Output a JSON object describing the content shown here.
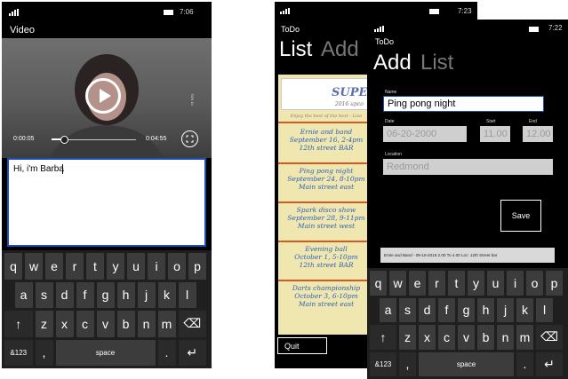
{
  "phone1": {
    "status_time": "7:06",
    "title": "Video",
    "elapsed": "0:00:05",
    "duration": "0:04:55",
    "text_value": "Hi, i'm Barba",
    "side_text": "TDN 10",
    "keyboard": {
      "row1": [
        "q",
        "w",
        "e",
        "r",
        "t",
        "y",
        "u",
        "i",
        "o",
        "p"
      ],
      "row2": [
        "a",
        "s",
        "d",
        "f",
        "g",
        "h",
        "j",
        "k",
        "l"
      ],
      "row3": [
        "z",
        "x",
        "c",
        "v",
        "b",
        "n",
        "m"
      ],
      "shift": "↑",
      "backspace": "⌫",
      "numbers": "&123",
      "comma": ",",
      "space": "space",
      "period": ".",
      "enter": "↵"
    }
  },
  "phone2": {
    "status_time": "7:23",
    "app_title": "ToDo",
    "pivot_active": "List",
    "pivot_inactive": "Add",
    "flyer_header": "SUPER",
    "flyer_sub": "2016 upco",
    "flyer_tagline": "Enjoy the best of the best - Live",
    "events": [
      [
        "Ernie and band",
        "September 16, 2-4pm",
        "12th street BAR"
      ],
      [
        "Ping pong night",
        "September 24, 8-10pm",
        "Main street east"
      ],
      [
        "Spark disco show",
        "September 28, 9-11pm",
        "Main street west"
      ],
      [
        "Evening ball",
        "October 1, 5-10pm",
        "12th street BAR"
      ],
      [
        "Darts championship",
        "October 3, 6-10pm",
        "Main street east"
      ]
    ],
    "quit_label": "Quit"
  },
  "phone3": {
    "status_time": "7:22",
    "app_title": "ToDo",
    "pivot_active": "Add",
    "pivot_inactive": "List",
    "name_label": "Name",
    "name_value": "Ping pong night",
    "date_label": "Date",
    "date_value": "06-20-2000",
    "start_label": "Start",
    "start_value": "11.00",
    "end_label": "End",
    "end_value": "12.00",
    "location_label": "Location",
    "location_value": "Redmond",
    "save_label": "Save",
    "list_entry": "Ernie and Band  -  09-16-2016 2.00 To 4.00 Loc: 12th Street bar",
    "keyboard": {
      "row1": [
        "q",
        "w",
        "e",
        "r",
        "t",
        "y",
        "u",
        "i",
        "o",
        "p"
      ],
      "row2": [
        "a",
        "s",
        "d",
        "f",
        "g",
        "h",
        "j",
        "k",
        "l"
      ],
      "row3": [
        "z",
        "x",
        "c",
        "v",
        "b",
        "n",
        "m"
      ],
      "shift": "↑",
      "backspace": "⌫",
      "numbers": "&123",
      "comma": ",",
      "space": "space",
      "period": ".",
      "enter": "↵"
    }
  },
  "video_progress": 0.15
}
